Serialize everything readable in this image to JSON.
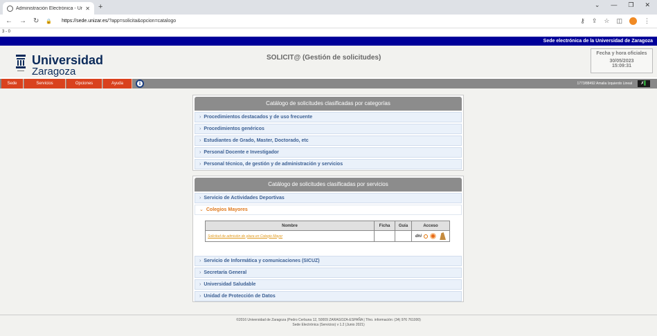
{
  "browser": {
    "tab_title": "Administración Electrónica - Univ",
    "url_host": "https://sede.unizar.es",
    "url_path": "/?app=solicita&opcion=catalogo",
    "zoom_label": "3 - 0"
  },
  "site": {
    "top_strip": "Sede electrónica de la Universidad de Zaragoza",
    "logo_line1": "Universidad",
    "logo_line2": "Zaragoza",
    "app_title": "SOLICIT@ (Gestión de solicitudes)",
    "date_title": "Fecha y hora oficiales",
    "date": "30/05/2023",
    "time": "15:09:31"
  },
  "menu": {
    "items": [
      {
        "label": "Sede"
      },
      {
        "label": "Servicios"
      },
      {
        "label": "Opciones"
      },
      {
        "label": "Ayuda"
      }
    ],
    "user": "1773/88492 Amalia Izquierdo Lineal"
  },
  "panel1": {
    "title": "Catálogo de solicitudes clasificadas por categorías",
    "items": [
      {
        "label": "Procedimientos destacados y de uso frecuente"
      },
      {
        "label": "Procedimientos genéricos"
      },
      {
        "label": "Estudiantes de Grado, Master, Doctorado, etc"
      },
      {
        "label": "Personal Docente e Investigador"
      },
      {
        "label": "Personal técnico, de gestión y de administración y servicios"
      }
    ]
  },
  "panel2": {
    "title": "Catálogo de solicitudes clasificadas por servicios",
    "items": [
      {
        "label": "Servicio de Actividades Deportivas"
      },
      {
        "label": "Colegios Mayores"
      },
      {
        "label": "Servicio de Informática y comunicaciones (SICUZ)"
      },
      {
        "label": "Secretaría General"
      },
      {
        "label": "Universidad Saludable"
      },
      {
        "label": "Unidad de Protección de Datos"
      }
    ],
    "table": {
      "headers": [
        "Nombre",
        "Ficha",
        "Guía",
        "Acceso"
      ],
      "row_link": "Solicitud de admisión de plaza en Colegio Mayor",
      "dni_label": "dni"
    }
  },
  "footer": {
    "line1": "©2016 Universidad de Zaragoza (Pedro Cerbuna 12, 50009 ZARAGOZA-ESPAÑA | Tfno. información: (34) 976 761000)",
    "line2": "Sede Electrónica (Servicios) v 1.2 (Junio 2021)"
  }
}
